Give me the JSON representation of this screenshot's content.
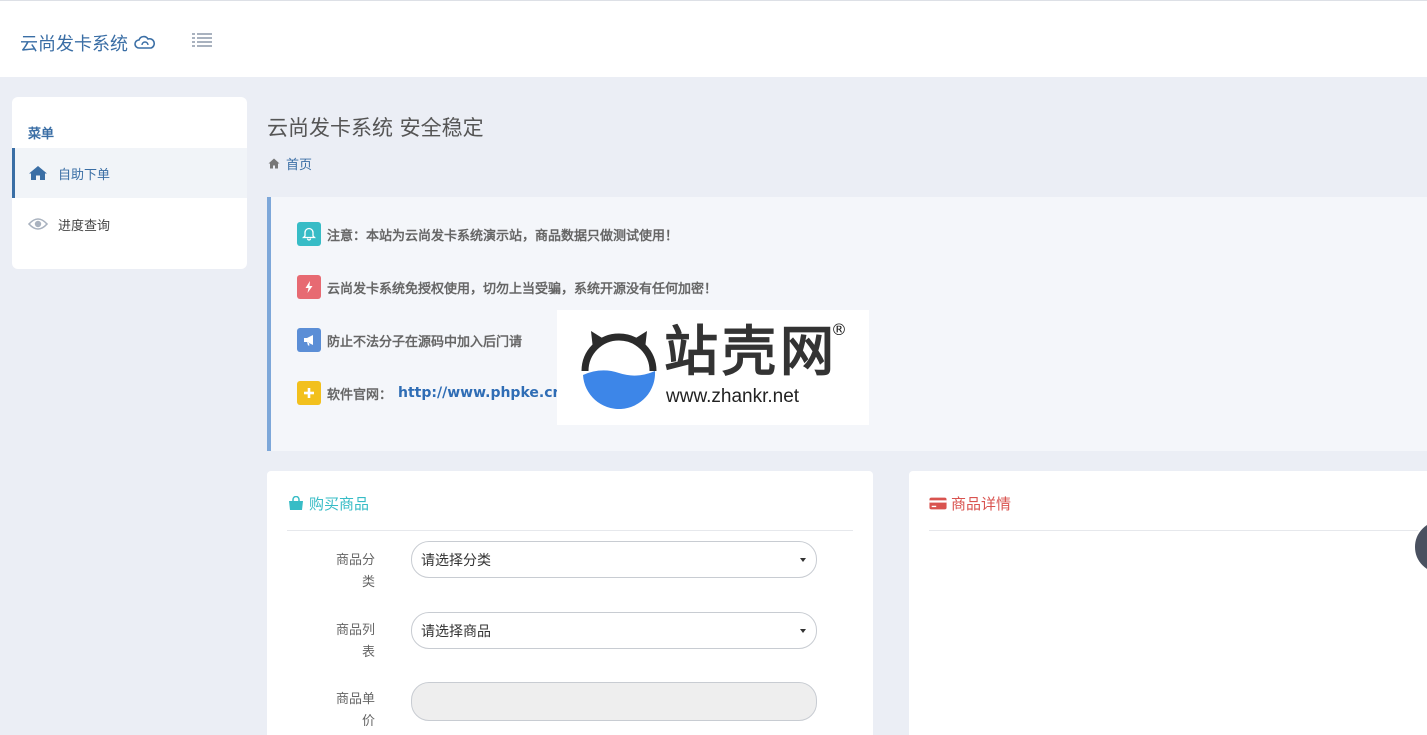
{
  "header": {
    "brand": "云尚发卡系统",
    "brand_icon": "cloud-icon",
    "toggle_icon": "list-icon"
  },
  "sidebar": {
    "heading": "菜单",
    "items": [
      {
        "label": "自助下单",
        "icon": "home-icon",
        "active": true
      },
      {
        "label": "进度查询",
        "icon": "eye-icon",
        "active": false
      }
    ]
  },
  "page": {
    "title": "云尚发卡系统 安全稳定",
    "breadcrumb": "首页"
  },
  "notices": [
    {
      "icon": "bell-icon",
      "color": "#37bcc6",
      "text": "注意：本站为云尚发卡系统演示站，商品数据只做测试使用！"
    },
    {
      "icon": "bolt-icon",
      "color": "#e76a72",
      "text": "云尚发卡系统免授权使用，切勿上当受骗，系统开源没有任何加密！"
    },
    {
      "icon": "megaphone-icon",
      "color": "#5b8ed6",
      "text": "防止不法分子在源码中加入后门请"
    },
    {
      "icon": "plus-icon",
      "color": "#f2c01d",
      "text": "软件官网：",
      "link": "http://www.phpke.cn"
    }
  ],
  "watermark": {
    "title": "站壳网",
    "url": "www.zhankr.net",
    "mark": "®"
  },
  "buy_panel": {
    "title": "购买商品",
    "icon": "shopping-bag-icon",
    "color": "#37bcc6",
    "fields": [
      {
        "label_line1": "商品分",
        "label_line2": "类",
        "value": "请选择分类"
      },
      {
        "label_line1": "商品列",
        "label_line2": "表",
        "value": "请选择商品"
      },
      {
        "label_line1": "商品单",
        "label_line2": "价",
        "value": ""
      }
    ]
  },
  "detail_panel": {
    "title": "商品详情",
    "icon": "credit-card-icon",
    "color": "#d9534f"
  }
}
